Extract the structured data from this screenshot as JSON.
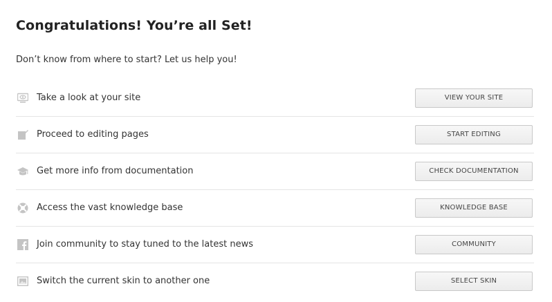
{
  "header": {
    "title": "Congratulations! You’re all Set!",
    "subtitle": "Don’t know from where to start? Let us help you!"
  },
  "rows": [
    {
      "icon": "monitor-eye-icon",
      "text": "Take a look at your site",
      "button": "VIEW YOUR SITE"
    },
    {
      "icon": "edit-note-icon",
      "text": "Proceed to editing pages",
      "button": "START EDITING"
    },
    {
      "icon": "graduation-cap-icon",
      "text": "Get more info from documentation",
      "button": "CHECK DOCUMENTATION"
    },
    {
      "icon": "lifebuoy-icon",
      "text": "Access the vast knowledge base",
      "button": "KNOWLEDGE BASE"
    },
    {
      "icon": "facebook-icon",
      "text": "Join community to stay tuned to the latest news",
      "button": "COMMUNITY"
    },
    {
      "icon": "image-frame-icon",
      "text": "Switch the current skin to another one",
      "button": "SELECT SKIN"
    }
  ],
  "colors": {
    "icon": "#c4c4c4",
    "divider": "#e4e4e4",
    "button_border": "#c8c8c8"
  }
}
